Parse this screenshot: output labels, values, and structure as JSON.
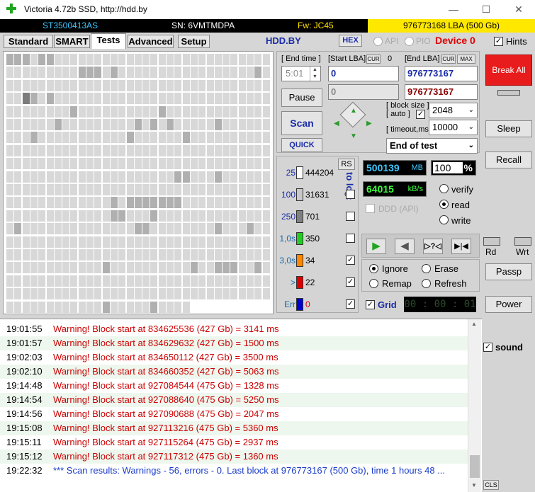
{
  "window": {
    "title": "Victoria 4.72b SSD, http://hdd.by"
  },
  "info": {
    "model": "ST3500413AS",
    "serial": "SN: 6VMTMDPA",
    "firmware": "Fw: JC45",
    "capacity": "976773168 LBA (500 Gb)"
  },
  "tabs": [
    {
      "label": "Standard"
    },
    {
      "label": "SMART"
    },
    {
      "label": "Tests"
    },
    {
      "label": "Advanced"
    },
    {
      "label": "Setup"
    }
  ],
  "toolbar": {
    "hddby": "HDD.BY",
    "hex": "HEX",
    "api": "API",
    "pio": "PIO",
    "device": "Device 0",
    "hints": "Hints"
  },
  "tests": {
    "end_time_label": "[ End time ]",
    "end_time_value": "5:01",
    "start_lba_label": "[Start LBA]",
    "cur_label": "CUR",
    "cur_value": "0",
    "start_lba_value": "0",
    "start_lba_cur_value": "0",
    "end_lba_label": "[End LBA]",
    "end_lba_cur": "CUR",
    "max_label": "MAX",
    "end_lba_value": "976773167",
    "end_lba_cur_value": "976773167",
    "pause_label": "Pause",
    "scan_label": "Scan",
    "quick_label": "QUICK",
    "block_size_label": "[ block size ]",
    "auto_label": "[ auto ]",
    "block_size_value": "2048",
    "timeout_label": "[ timeout,ms ]",
    "timeout_value": "10000",
    "end_of_test": "End of test",
    "rs_label": "RS",
    "to_log_label": "to log:",
    "legend": [
      {
        "label": "25",
        "count": "444204",
        "color": "#ffffff",
        "checked": false
      },
      {
        "label": "100",
        "count": "31631",
        "color": "#c8c8c8",
        "checked": false
      },
      {
        "label": "250",
        "count": "701",
        "color": "#808080",
        "checked": false
      },
      {
        "label": "1,0s",
        "count": "350",
        "color": "#22cc22",
        "checked": false
      },
      {
        "label": "3,0s",
        "count": "34",
        "color": "#ff8800",
        "checked": true
      },
      {
        "label": ">",
        "count": "22",
        "color": "#dd0000",
        "checked": true
      },
      {
        "label": "Err",
        "count": "0",
        "color": "#0000cc",
        "checked": true
      }
    ],
    "mb_value": "500139",
    "mb_unit": "MB",
    "percent_value": "100",
    "percent_unit": "%",
    "speed_value": "64015",
    "speed_unit": "kB/s",
    "verify_label": "verify",
    "read_label": "read",
    "write_label": "write",
    "ddd_label": "DDD (API)",
    "ignore_label": "Ignore",
    "erase_label": "Erase",
    "remap_label": "Remap",
    "refresh_label": "Refresh",
    "grid_label": "Grid",
    "timer": "00 : 00 : 01"
  },
  "right": {
    "break_all": "Break All",
    "sleep": "Sleep",
    "recall": "Recall",
    "rd": "Rd",
    "wrt": "Wrt",
    "passp": "Passp",
    "power": "Power",
    "sound": "sound",
    "cls": "CLS"
  },
  "log": [
    {
      "time": "19:01:55",
      "msg": "Warning! Block start at 834625536 (427 Gb)  = 3141 ms",
      "color": "#cc0000"
    },
    {
      "time": "19:01:57",
      "msg": "Warning! Block start at 834629632 (427 Gb)  = 1500 ms",
      "color": "#cc0000"
    },
    {
      "time": "19:02:03",
      "msg": "Warning! Block start at 834650112 (427 Gb)  = 3500 ms",
      "color": "#cc0000"
    },
    {
      "time": "19:02:10",
      "msg": "Warning! Block start at 834660352 (427 Gb)  = 5063 ms",
      "color": "#cc0000"
    },
    {
      "time": "19:14:48",
      "msg": "Warning! Block start at 927084544 (475 Gb)  = 1328 ms",
      "color": "#cc0000"
    },
    {
      "time": "19:14:54",
      "msg": "Warning! Block start at 927088640 (475 Gb)  = 5250 ms",
      "color": "#cc0000"
    },
    {
      "time": "19:14:56",
      "msg": "Warning! Block start at 927090688 (475 Gb)  = 2047 ms",
      "color": "#cc0000"
    },
    {
      "time": "19:15:08",
      "msg": "Warning! Block start at 927113216 (475 Gb)  = 5360 ms",
      "color": "#cc0000"
    },
    {
      "time": "19:15:11",
      "msg": "Warning! Block start at 927115264 (475 Gb)  = 2937 ms",
      "color": "#cc0000"
    },
    {
      "time": "19:15:12",
      "msg": "Warning! Block start at 927117312 (475 Gb)  = 1360 ms",
      "color": "#cc0000"
    },
    {
      "time": "19:22:32",
      "msg": "*** Scan results: Warnings - 56, errors - 0. Last block at 976773167 (500 Gb), time 1 hours 48 ...",
      "color": "#1a3cc8"
    }
  ]
}
